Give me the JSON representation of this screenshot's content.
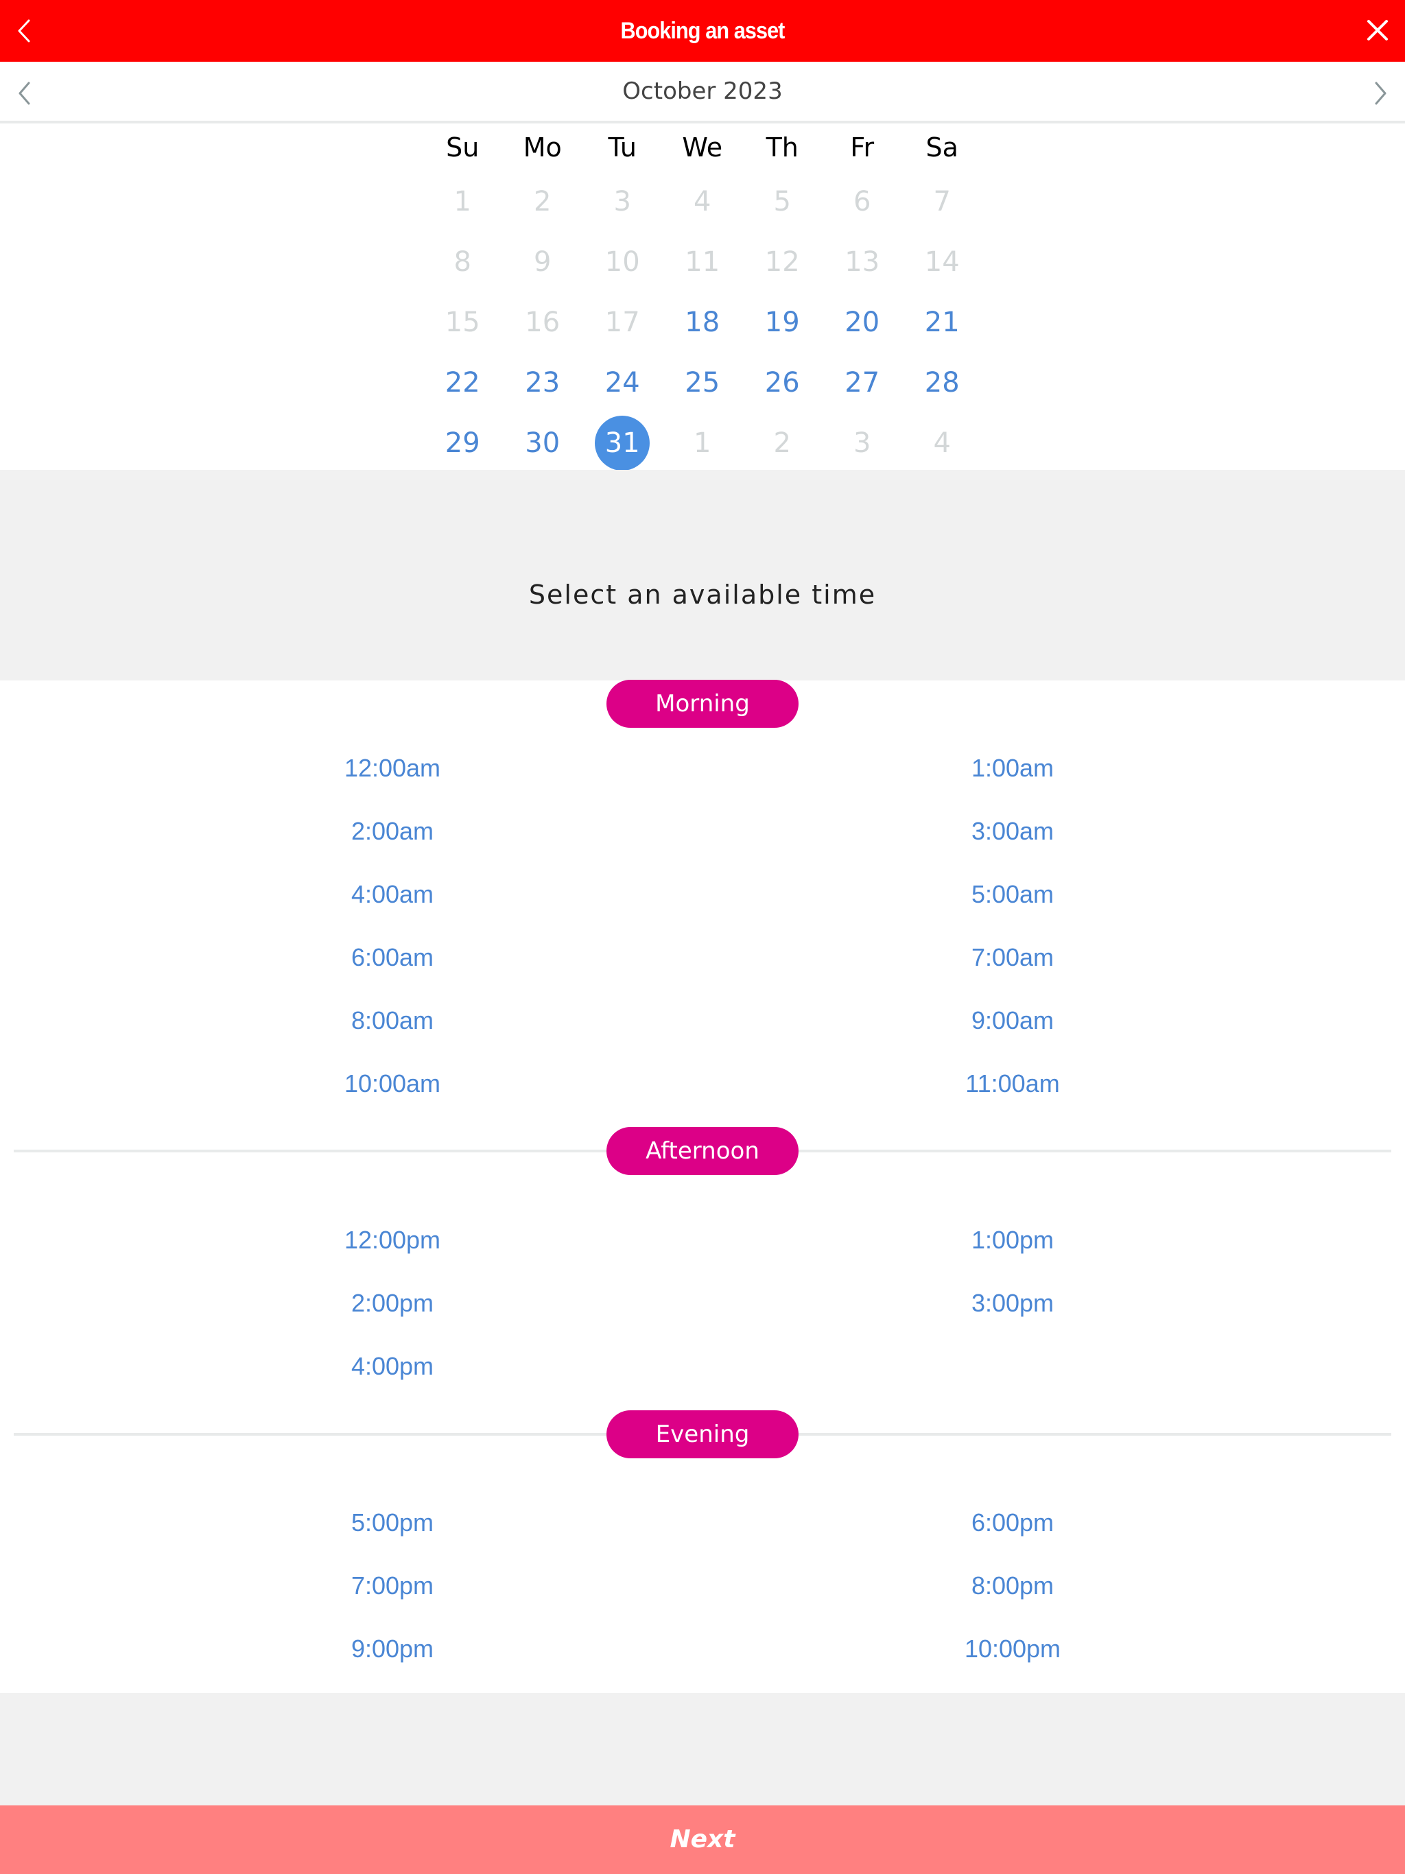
{
  "header": {
    "title": "Booking an asset",
    "back_icon": "chevron-left-icon",
    "close_icon": "close-icon"
  },
  "calendar": {
    "month_label": "October 2023",
    "prev_icon": "chevron-left-icon",
    "next_icon": "chevron-right-icon",
    "weekdays": [
      "Su",
      "Mo",
      "Tu",
      "We",
      "Th",
      "Fr",
      "Sa"
    ],
    "days": [
      {
        "label": "1",
        "state": "disabled"
      },
      {
        "label": "2",
        "state": "disabled"
      },
      {
        "label": "3",
        "state": "disabled"
      },
      {
        "label": "4",
        "state": "disabled"
      },
      {
        "label": "5",
        "state": "disabled"
      },
      {
        "label": "6",
        "state": "disabled"
      },
      {
        "label": "7",
        "state": "disabled"
      },
      {
        "label": "8",
        "state": "disabled"
      },
      {
        "label": "9",
        "state": "disabled"
      },
      {
        "label": "10",
        "state": "disabled"
      },
      {
        "label": "11",
        "state": "disabled"
      },
      {
        "label": "12",
        "state": "disabled"
      },
      {
        "label": "13",
        "state": "disabled"
      },
      {
        "label": "14",
        "state": "disabled"
      },
      {
        "label": "15",
        "state": "disabled"
      },
      {
        "label": "16",
        "state": "disabled"
      },
      {
        "label": "17",
        "state": "disabled"
      },
      {
        "label": "18",
        "state": "available"
      },
      {
        "label": "19",
        "state": "available"
      },
      {
        "label": "20",
        "state": "available"
      },
      {
        "label": "21",
        "state": "available"
      },
      {
        "label": "22",
        "state": "available"
      },
      {
        "label": "23",
        "state": "available"
      },
      {
        "label": "24",
        "state": "available"
      },
      {
        "label": "25",
        "state": "available"
      },
      {
        "label": "26",
        "state": "available"
      },
      {
        "label": "27",
        "state": "available"
      },
      {
        "label": "28",
        "state": "available"
      },
      {
        "label": "29",
        "state": "available"
      },
      {
        "label": "30",
        "state": "available"
      },
      {
        "label": "31",
        "state": "selected"
      },
      {
        "label": "1",
        "state": "disabled"
      },
      {
        "label": "2",
        "state": "disabled"
      },
      {
        "label": "3",
        "state": "disabled"
      },
      {
        "label": "4",
        "state": "disabled"
      }
    ],
    "selected_date": "31"
  },
  "time_prompt": "Select an available time",
  "sections": [
    {
      "label": "Morning",
      "times": [
        "12:00am",
        "1:00am",
        "2:00am",
        "3:00am",
        "4:00am",
        "5:00am",
        "6:00am",
        "7:00am",
        "8:00am",
        "9:00am",
        "10:00am",
        "11:00am"
      ]
    },
    {
      "label": "Afternoon",
      "times": [
        "12:00pm",
        "1:00pm",
        "2:00pm",
        "3:00pm",
        "4:00pm"
      ]
    },
    {
      "label": "Evening",
      "times": [
        "5:00pm",
        "6:00pm",
        "7:00pm",
        "8:00pm",
        "9:00pm",
        "10:00pm"
      ]
    }
  ],
  "footer": {
    "next_label": "Next"
  },
  "colors": {
    "header_bg": "#ff0000",
    "accent_blue": "#4a90e2",
    "available_text": "#4a86d4",
    "disabled_text": "#d3d7d8",
    "pill_bg": "#dc0087",
    "next_bg": "#ff8080"
  }
}
